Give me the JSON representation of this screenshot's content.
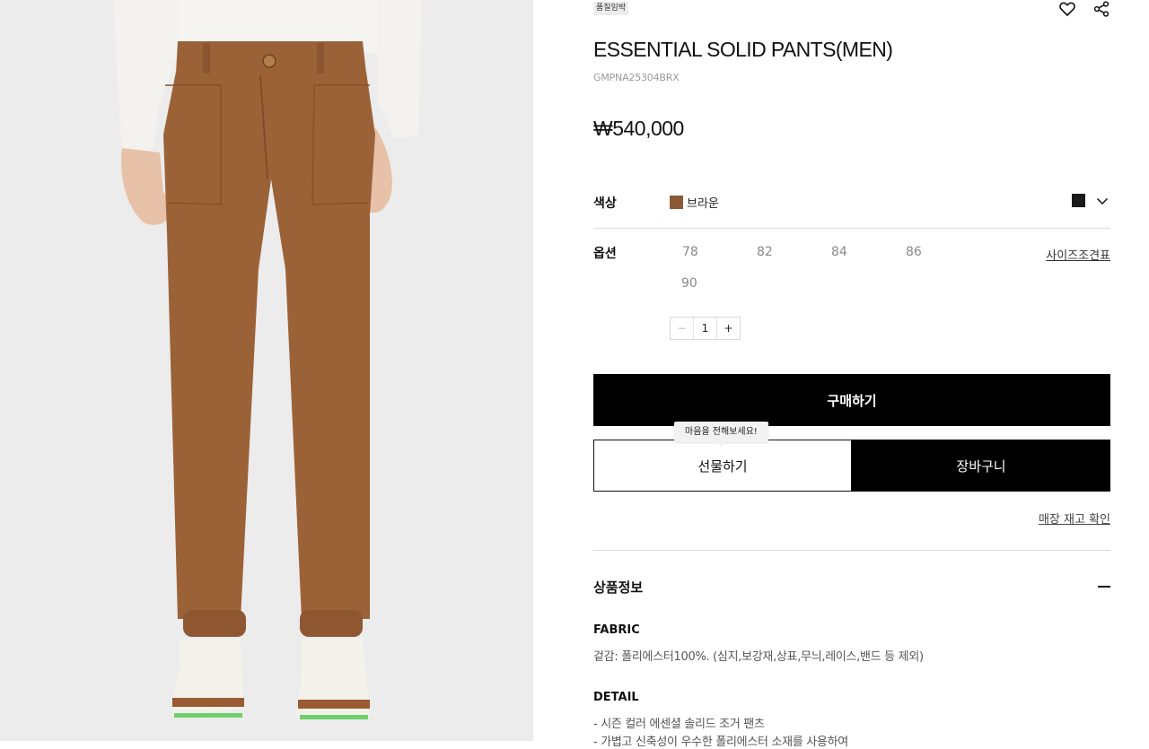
{
  "product": {
    "badge": "품질임박",
    "title": "ESSENTIAL SOLID PANTS(MEN)",
    "sku": "GMPNA25304BRX",
    "price": "₩540,000"
  },
  "options": {
    "color_label": "색상",
    "color_name": "브라운",
    "color_hex": "#8a5a35",
    "option_label": "옵션",
    "sizes": [
      "78",
      "82",
      "84",
      "86",
      "90"
    ],
    "size_chart_label": "사이즈조견표",
    "quantity": "1",
    "minus_symbol": "−",
    "plus_symbol": "+"
  },
  "actions": {
    "buy_label": "구매하기",
    "gift_tooltip": "마음을 전해보세요!",
    "gift_label": "선물하기",
    "cart_label": "장바구니",
    "store_stock_label": "매장 재고 확인"
  },
  "info": {
    "section_title": "상품정보",
    "fabric_title": "FABRIC",
    "fabric_text": "겉감: 폴리에스터100%. (심지,보강재,상표,무늬,레이스,밴드 등 제외)",
    "detail_title": "DETAIL",
    "detail_lines": [
      "- 시즌 컬러 에센셜 솔리드 조거 팬츠",
      "- 가볍고 신축성이 우수한 폴리에스터 소재를 사용하여"
    ]
  },
  "icons": {
    "wishlist": "heart-icon",
    "share": "share-icon",
    "dropdown": "chevron-down-icon",
    "collapse": "minus-icon"
  }
}
